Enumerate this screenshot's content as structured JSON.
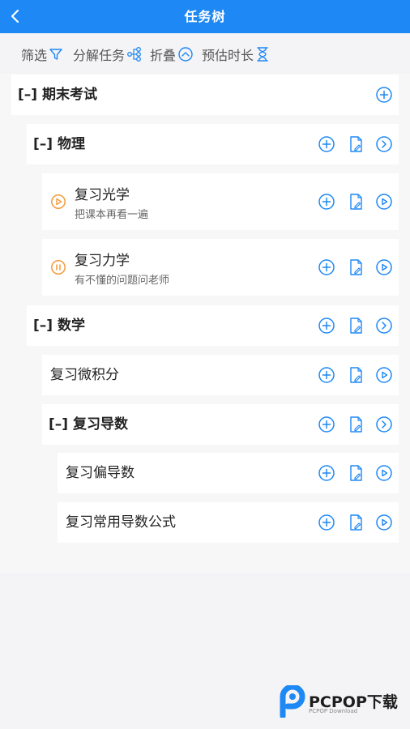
{
  "header": {
    "title": "任务树"
  },
  "toolbar": {
    "filter_label": "筛选",
    "decompose_label": "分解任务",
    "collapse_label": "折叠",
    "estimate_label": "预估时长"
  },
  "tree": {
    "root": {
      "label": "[–] 期末考试"
    },
    "physics": {
      "label": "[–] 物理"
    },
    "optics": {
      "title": "复习光学",
      "note": "把课本再看一遍",
      "status": "play"
    },
    "mechanics": {
      "title": "复习力学",
      "note": "有不懂的问题问老师",
      "status": "pause"
    },
    "math": {
      "label": "[–] 数学"
    },
    "calculus": {
      "label": "复习微积分"
    },
    "derivative": {
      "label": "[–] 复习导数"
    },
    "partial": {
      "label": "复习偏导数"
    },
    "formulas": {
      "label": "复习常用导数公式"
    }
  },
  "watermark": {
    "brand": "PCPOP下载",
    "sub": "PCPOP Download"
  },
  "colors": {
    "accent": "#1e88f5",
    "status_orange": "#f39a3c"
  }
}
